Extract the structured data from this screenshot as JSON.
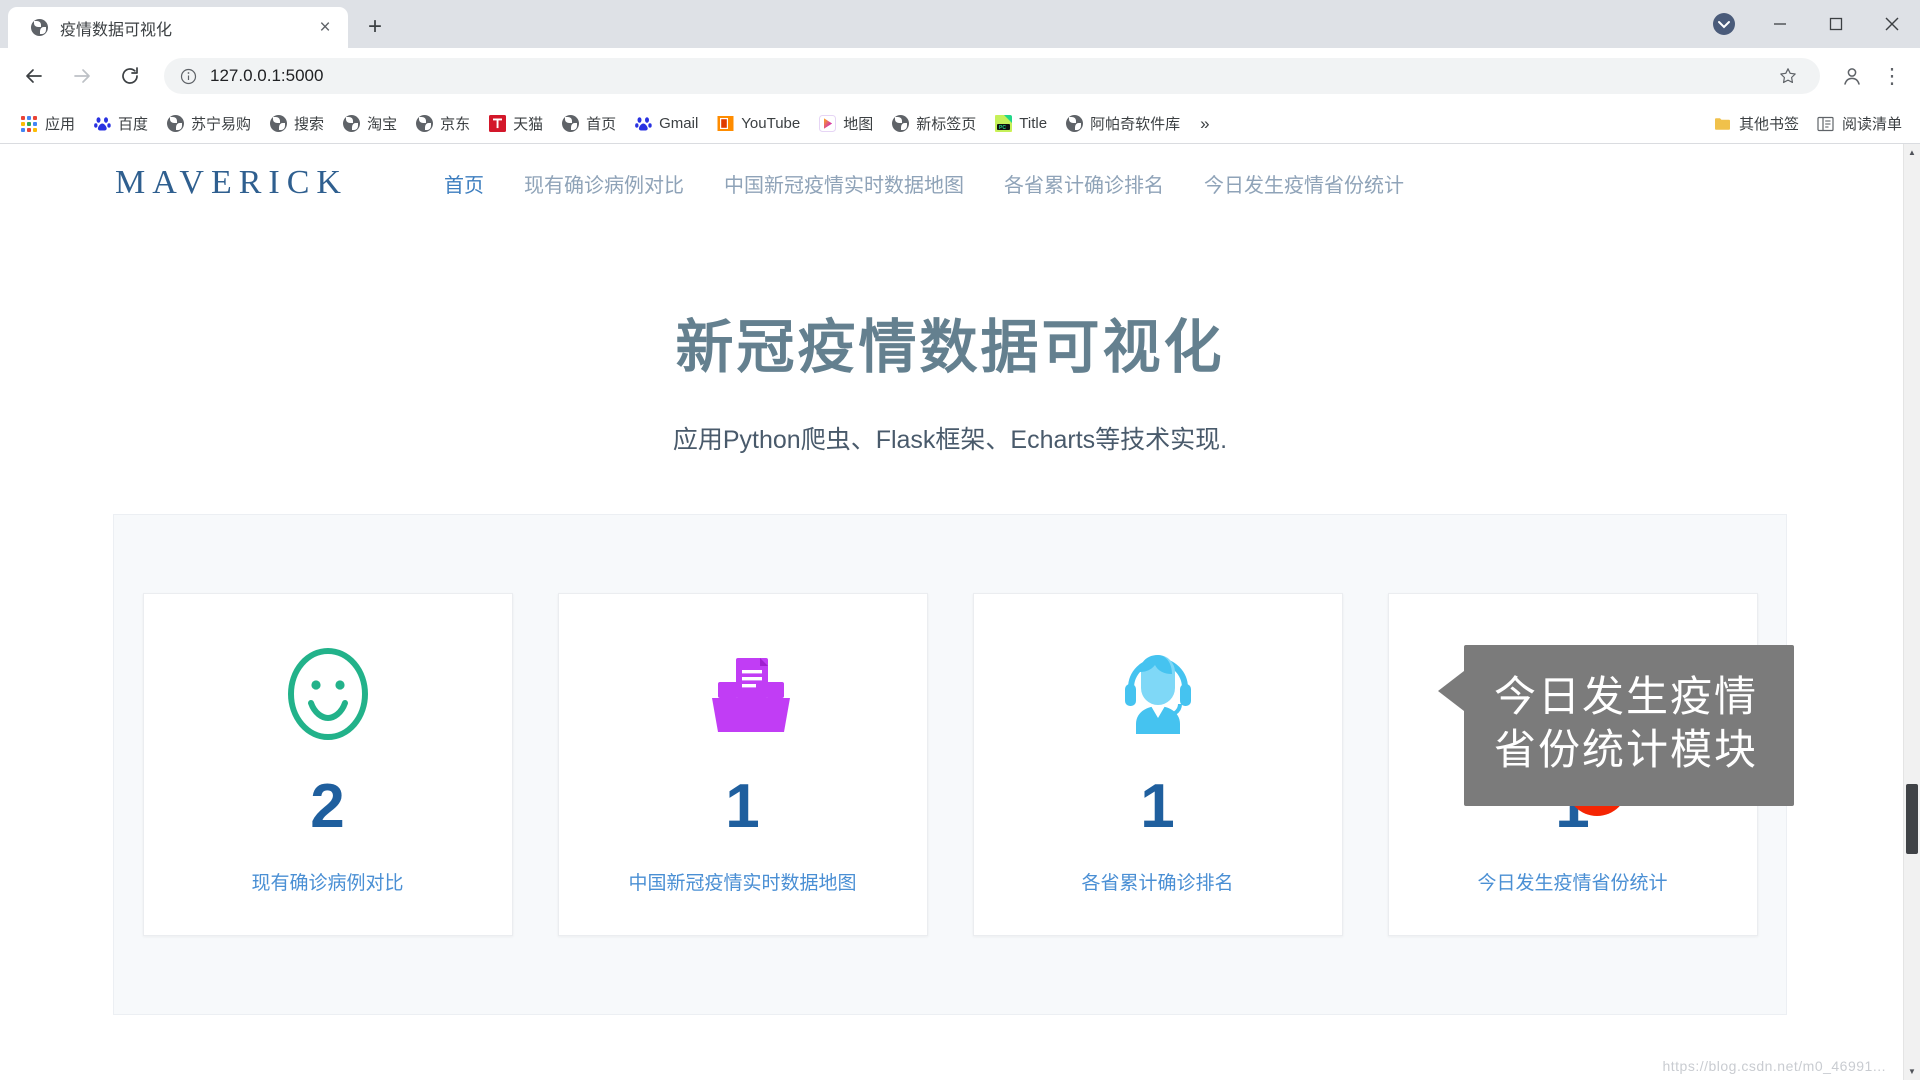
{
  "browser": {
    "tab": {
      "title": "疫情数据可视化",
      "favicon": "globe-icon",
      "close": "×"
    },
    "newtab_label": "+",
    "window_controls": {
      "minimize": "—",
      "maximize": "□",
      "close": "✕",
      "profile": "avatar-icon"
    },
    "toolbar": {
      "back": "←",
      "forward": "→",
      "reload": "⟳",
      "url": "127.0.0.1:5000",
      "info_icon": "info-circle-icon",
      "star": "☆",
      "avatar": "profile-icon",
      "menu": "⋮"
    },
    "bookmarks": {
      "items": [
        {
          "label": "应用",
          "icon": "apps-grid-icon"
        },
        {
          "label": "百度",
          "icon": "baidu-icon"
        },
        {
          "label": "苏宁易购",
          "icon": "globe-icon"
        },
        {
          "label": "搜索",
          "icon": "globe-icon"
        },
        {
          "label": "淘宝",
          "icon": "globe-icon"
        },
        {
          "label": "京东",
          "icon": "globe-icon"
        },
        {
          "label": "天猫",
          "icon": "tmall-icon"
        },
        {
          "label": "首页",
          "icon": "globe-icon"
        },
        {
          "label": "Gmail",
          "icon": "baidu-icon"
        },
        {
          "label": "YouTube",
          "icon": "youtube-icon"
        },
        {
          "label": "地图",
          "icon": "maps-icon"
        },
        {
          "label": "新标签页",
          "icon": "globe-icon"
        },
        {
          "label": "Title",
          "icon": "pycharm-icon"
        },
        {
          "label": "阿帕奇软件库",
          "icon": "globe-icon"
        }
      ],
      "overflow": "»",
      "other_bookmarks": {
        "label": "其他书签",
        "icon": "folder-icon"
      },
      "reading_list": {
        "label": "阅读清单",
        "icon": "reading-list-icon"
      }
    }
  },
  "site": {
    "brand": "MAVERICK",
    "nav": [
      {
        "label": "首页",
        "active": true
      },
      {
        "label": "现有确诊病例对比",
        "active": false
      },
      {
        "label": "中国新冠疫情实时数据地图",
        "active": false
      },
      {
        "label": "各省累计确诊排名",
        "active": false
      },
      {
        "label": "今日发生疫情省份统计",
        "active": false
      }
    ],
    "hero": {
      "title": "新冠疫情数据可视化",
      "subtitle": "应用Python爬虫、Flask框架、Echarts等技术实现."
    },
    "cards": [
      {
        "number": "2",
        "label": "现有确诊病例对比",
        "icon": "smiley-face-icon",
        "color": "#22b28a"
      },
      {
        "number": "1",
        "label": "中国新冠疫情实时数据地图",
        "icon": "document-tray-icon",
        "color": "#c13df5"
      },
      {
        "number": "1",
        "label": "各省累计确诊排名",
        "icon": "headset-support-icon",
        "color": "#45c3f0"
      },
      {
        "number": "1",
        "label": "今日发生疫情省份统计",
        "icon": "user-group-icon",
        "color": "#f5a council"
      }
    ],
    "callout": {
      "text": "今日发生疫情省份统计模块",
      "badge": "1"
    },
    "watermark": "https://blog.csdn.net/m0_46991..."
  },
  "colors": {
    "brand": "#2f5f8f",
    "nav_active": "#3d7ebf",
    "nav_idle": "#8fa3b8",
    "hero_title": "#64808f",
    "card_number": "#1f5f9e",
    "card_label": "#4a8fd4",
    "badge_red": "#f52503",
    "callout_bg": "#7b7b7b",
    "panel_bg": "#f7f9fb"
  }
}
